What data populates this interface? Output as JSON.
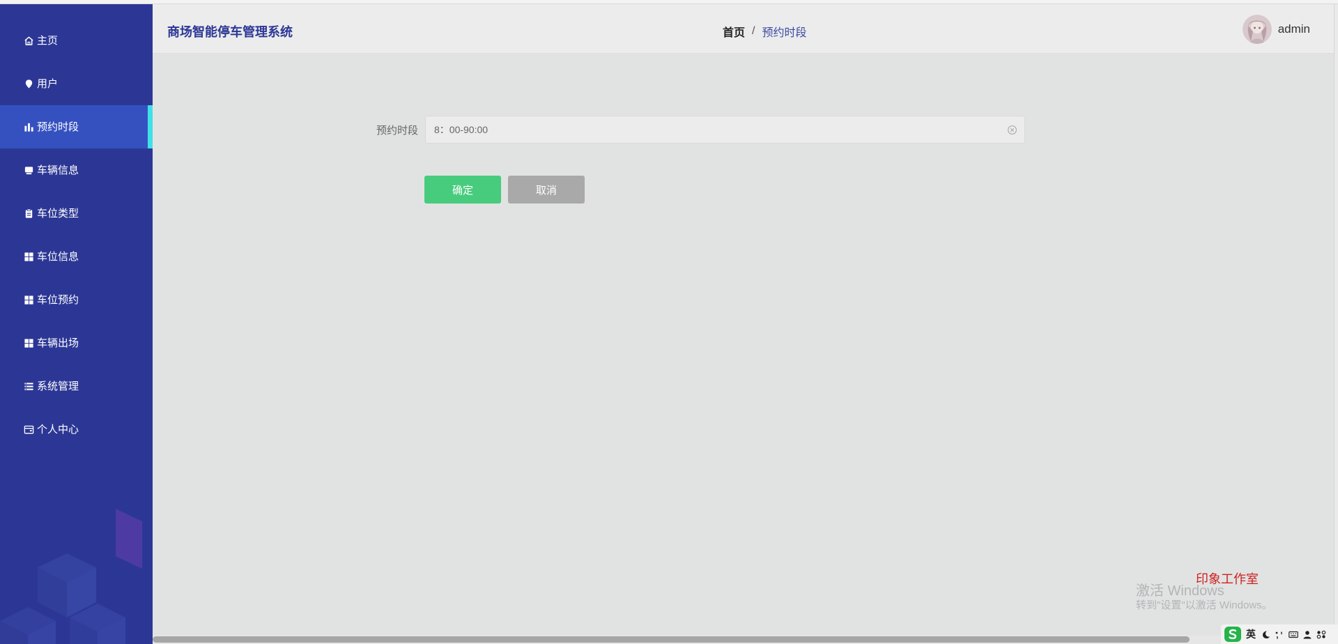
{
  "header": {
    "app_title": "商场智能停车管理系统",
    "breadcrumb": {
      "home": "首页",
      "separator": "/",
      "current": "预约时段"
    },
    "user": {
      "name": "admin"
    }
  },
  "sidebar": {
    "items": [
      {
        "label": "主页",
        "icon": "home-icon"
      },
      {
        "label": "用户",
        "icon": "location-pin-icon"
      },
      {
        "label": "预约时段",
        "icon": "bar-chart-icon",
        "active": true
      },
      {
        "label": "车辆信息",
        "icon": "monitor-icon"
      },
      {
        "label": "车位类型",
        "icon": "clipboard-icon"
      },
      {
        "label": "车位信息",
        "icon": "grid-icon"
      },
      {
        "label": "车位预约",
        "icon": "grid-icon"
      },
      {
        "label": "车辆出场",
        "icon": "grid-icon"
      },
      {
        "label": "系统管理",
        "icon": "list-icon"
      },
      {
        "label": "个人中心",
        "icon": "card-icon"
      }
    ]
  },
  "form": {
    "field_label": "预约时段",
    "field_value": "8：00-90:00",
    "confirm_label": "确定",
    "cancel_label": "取消"
  },
  "watermarks": {
    "studio": "印象工作室",
    "windows_title": "激活 Windows",
    "windows_subtitle": "转到\"设置\"以激活 Windows。"
  },
  "ime": {
    "lang": "英"
  },
  "colors": {
    "sidebar_bg": "#2c3795",
    "sidebar_active": "#3551c0",
    "active_indicator": "#40e0e8",
    "confirm_button": "#47cc7d",
    "cancel_button": "#a9a9a9",
    "title_color": "#2c3795"
  }
}
